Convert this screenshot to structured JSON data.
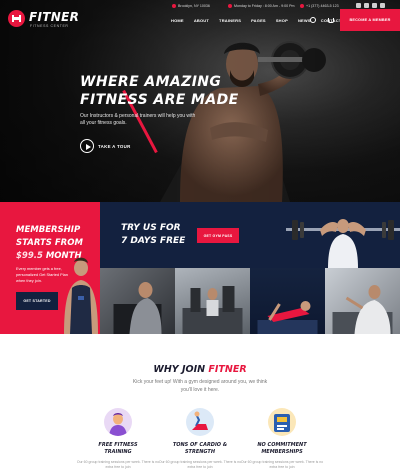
{
  "brand": {
    "name": "FITNER",
    "tagline": "FITNESS CENTER",
    "accent": "#e8173f",
    "navy": "#13213f"
  },
  "topinfo": {
    "address": "Brooklyn, NY 10036",
    "hours": "Monday to Friday : 8:00 Am - 9:00 Pm",
    "phone": "+1 (377) 4463-5 123"
  },
  "nav": {
    "items": [
      "HOME",
      "ABOUT",
      "TRAINERS",
      "PAGES",
      "SHOP",
      "NEWS",
      "CONTACT"
    ],
    "cart_count": "0",
    "cta": "BECOME A MEMBER"
  },
  "hero": {
    "title_line1": "WHERE AMAZING",
    "title_line2": "FITNESS ARE MADE",
    "text": "Our Instructors & personal trainers will help you with all your fitness goals.",
    "tour_label": "TAKE A TOUR"
  },
  "membership": {
    "line1": "MEMBERSHIP",
    "line2": "STARTS FROM",
    "price": "$99.5",
    "period": " MONTH",
    "text": "Every member gets a free, personalized Get Started Plan when they join.",
    "button": "GET STARTED"
  },
  "trial": {
    "line1": "TRY US FOR",
    "line2": "7 DAYS FREE",
    "button": "GET GYM PASS"
  },
  "why": {
    "title_prefix": "WHY JOIN ",
    "title_accent": "FITNER",
    "text": "Kick your feet up! With a gym designed around you, we think you'll love it here.",
    "features": [
      {
        "icon": "trainer-icon",
        "title_line1": "FREE FITNESS",
        "title_line2": "TRAINING",
        "text": "Our 60 group training sessions per week. There is no extra free to join"
      },
      {
        "icon": "cardio-icon",
        "title_line1": "TONS OF CARDIO &",
        "title_line2": "STRENGTH",
        "text": "Our 60 group training sessions per week. There is no extra free to join"
      },
      {
        "icon": "membership-card-icon",
        "title_line1": "NO COMMITMENT",
        "title_line2": "MEMBERSHIPS",
        "text": "Our 60 group training sessions per week. There is no extra free to join"
      }
    ]
  }
}
